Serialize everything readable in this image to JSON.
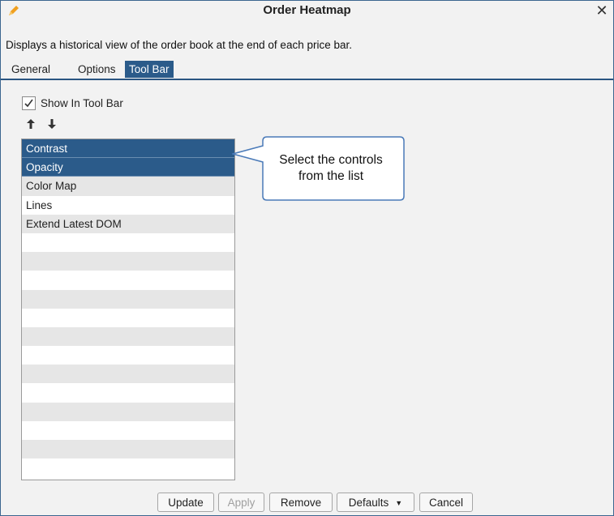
{
  "window": {
    "title": "Order Heatmap",
    "close_glyph": "✕",
    "title_icon": "pencil-icon"
  },
  "description": "Displays a historical view of the order book at the end of each price bar.",
  "tabs": [
    {
      "label": "General",
      "active": false
    },
    {
      "label": "Options",
      "active": false
    },
    {
      "label": "Tool Bar",
      "active": true
    }
  ],
  "show_in_toolbar": {
    "label": "Show In Tool Bar",
    "checked": true
  },
  "reorder": {
    "up_icon": "arrow-up-icon",
    "down_icon": "arrow-down-icon"
  },
  "list": {
    "items": [
      {
        "label": "Contrast",
        "selected": true
      },
      {
        "label": "Opacity",
        "selected": true
      },
      {
        "label": "Color Map",
        "selected": false
      },
      {
        "label": "Lines",
        "selected": false
      },
      {
        "label": "Extend Latest DOM",
        "selected": false
      }
    ],
    "empty_rows": 13
  },
  "callout": {
    "line1": "Select the controls",
    "line2": "from the list"
  },
  "buttons": {
    "update": "Update",
    "apply": "Apply",
    "remove": "Remove",
    "defaults": "Defaults",
    "cancel": "Cancel"
  },
  "colors": {
    "accent": "#2b5b8a",
    "callout_border": "#4a7ab8",
    "pencil": "#f0a020"
  }
}
